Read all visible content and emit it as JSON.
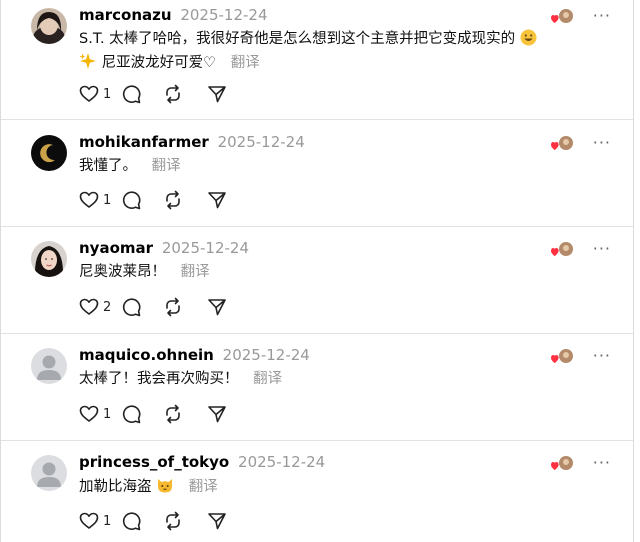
{
  "comments": [
    {
      "username": "marconazu",
      "date": "2025-12-24",
      "text": "S.T. 太棒了哈哈，我很好奇他是怎么想到这个主意并把它变成现实的",
      "text_tail": "尼亚波龙好可爱♡",
      "translate_label": "翻译",
      "likes": "1",
      "avatar": "photo-woman-dark-hair"
    },
    {
      "username": "mohikanfarmer",
      "date": "2025-12-24",
      "text": "我懂了。",
      "translate_label": "翻译",
      "likes": "1",
      "avatar": "crescent-moon"
    },
    {
      "username": "nyaomar",
      "date": "2025-12-24",
      "text": "尼奥波莱昂！",
      "translate_label": "翻译",
      "likes": "2",
      "avatar": "photo-woman-face"
    },
    {
      "username": "maquico.ohnein",
      "date": "2025-12-24",
      "text": "太棒了！我会再次购买！",
      "translate_label": "翻译",
      "likes": "1",
      "avatar": "default-avatar"
    },
    {
      "username": "princess_of_tokyo",
      "date": "2025-12-24",
      "text": "加勒比海盗",
      "translate_label": "翻译",
      "likes": "1",
      "avatar": "default-avatar"
    }
  ],
  "icons": {
    "like": "heart-icon",
    "comment": "comment-bubble-icon",
    "repost": "repost-icon",
    "share": "send-icon",
    "more": "more-options-icon",
    "author_liked": "author-liked-badge"
  },
  "more_glyph": "···",
  "colors": {
    "date": "#999999",
    "translate": "#9a9a9a",
    "heart_red": "#ff3040",
    "divider": "#e2e2e2"
  }
}
